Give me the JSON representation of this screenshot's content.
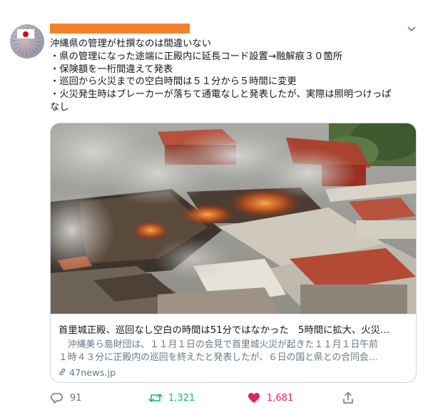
{
  "tweet": {
    "lines": [
      "沖縄県の管理が杜撰なのは間違いない",
      "・県の管理になった途端に正殿内に延長コード設置→融解痕３０箇所",
      "・保険額を一桁間違えて発表",
      "・巡回から火災までの空白時間は５１分から５時間に変更",
      "・火災発生時はブレーカーが落ちて通電なしと発表したが、実際は照明つけっぱ",
      "なし"
    ]
  },
  "card": {
    "title": "首里城正殿、巡回なし空白の時間は51分ではなかった　5時間に拡大、火災…",
    "description": [
      "　沖縄美ら島財団は、１１月１日の会見で首里城火災が起きた１１月１日午前",
      "１時４３分に正殿内の巡回を終えたと発表したが、６日の国と県との合同会…"
    ],
    "domain": "47news.jp"
  },
  "actions": {
    "reply_count": "91",
    "retweet_count": "1,321",
    "like_count": "1,681"
  },
  "colors": {
    "retweet": "#17bf63",
    "like": "#e0245e",
    "muted": "#657786",
    "redaction": "#f5822a"
  },
  "icons": [
    "more-options-icon",
    "link-icon",
    "reply-icon",
    "retweet-icon",
    "like-icon",
    "share-icon"
  ]
}
